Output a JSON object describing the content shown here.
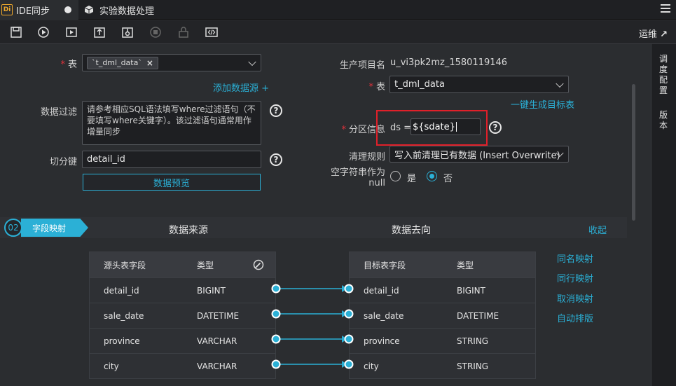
{
  "tabs": [
    {
      "logo": "Di",
      "label": "IDE同步"
    },
    {
      "icon": "cube-icon",
      "label": "实验数据处理"
    }
  ],
  "toolbar": {
    "buttons": [
      "save-icon",
      "run-icon",
      "run-params-icon",
      "submit-icon",
      "deploy-icon",
      "stop-icon",
      "lock-icon",
      "script-mode-icon"
    ],
    "ops_label": "运维"
  },
  "right_rail": [
    "调度配置",
    "版本"
  ],
  "source": {
    "table_label": "表",
    "table_tag": "`t_dml_data`",
    "add_source": "添加数据源 +",
    "filter_label": "数据过滤",
    "filter_placeholder": "请参考相应SQL语法填写where过滤语句（不要填写where关键字）。该过滤语句通常用作增量同步",
    "split_label": "切分键",
    "split_value": "detail_id",
    "preview_button": "数据预览"
  },
  "target": {
    "project_label": "生产项目名",
    "project_value": "u_vi3pk2mz_1580119146",
    "table_label": "表",
    "table_value": "t_dml_data",
    "gen_link": "一键生成目标表",
    "partition_label": "分区信息",
    "partition_key": "ds =",
    "partition_value": "${sdate}",
    "clean_label": "清理规则",
    "clean_value": "写入前清理已有数据 (Insert Overwrite)",
    "null_label": "空字符串作为null",
    "null_options": [
      "是",
      "否"
    ],
    "null_selected": "否"
  },
  "section": {
    "step": "02",
    "title": "字段映射",
    "source_title": "数据来源",
    "target_title": "数据去向",
    "collapse": "收起"
  },
  "mapping": {
    "source_headers": [
      "源头表字段",
      "类型"
    ],
    "target_headers": [
      "目标表字段",
      "类型"
    ],
    "source_rows": [
      {
        "field": "detail_id",
        "type": "BIGINT"
      },
      {
        "field": "sale_date",
        "type": "DATETIME"
      },
      {
        "field": "province",
        "type": "VARCHAR"
      },
      {
        "field": "city",
        "type": "VARCHAR"
      }
    ],
    "target_rows": [
      {
        "field": "detail_id",
        "type": "BIGINT"
      },
      {
        "field": "sale_date",
        "type": "DATETIME"
      },
      {
        "field": "province",
        "type": "STRING"
      },
      {
        "field": "city",
        "type": "STRING"
      }
    ],
    "actions": [
      "同名映射",
      "同行映射",
      "取消映射",
      "自动排版"
    ]
  },
  "colors": {
    "accent": "#2bb0d6",
    "required": "#e0313a",
    "highlight_box": "#e0202a"
  }
}
